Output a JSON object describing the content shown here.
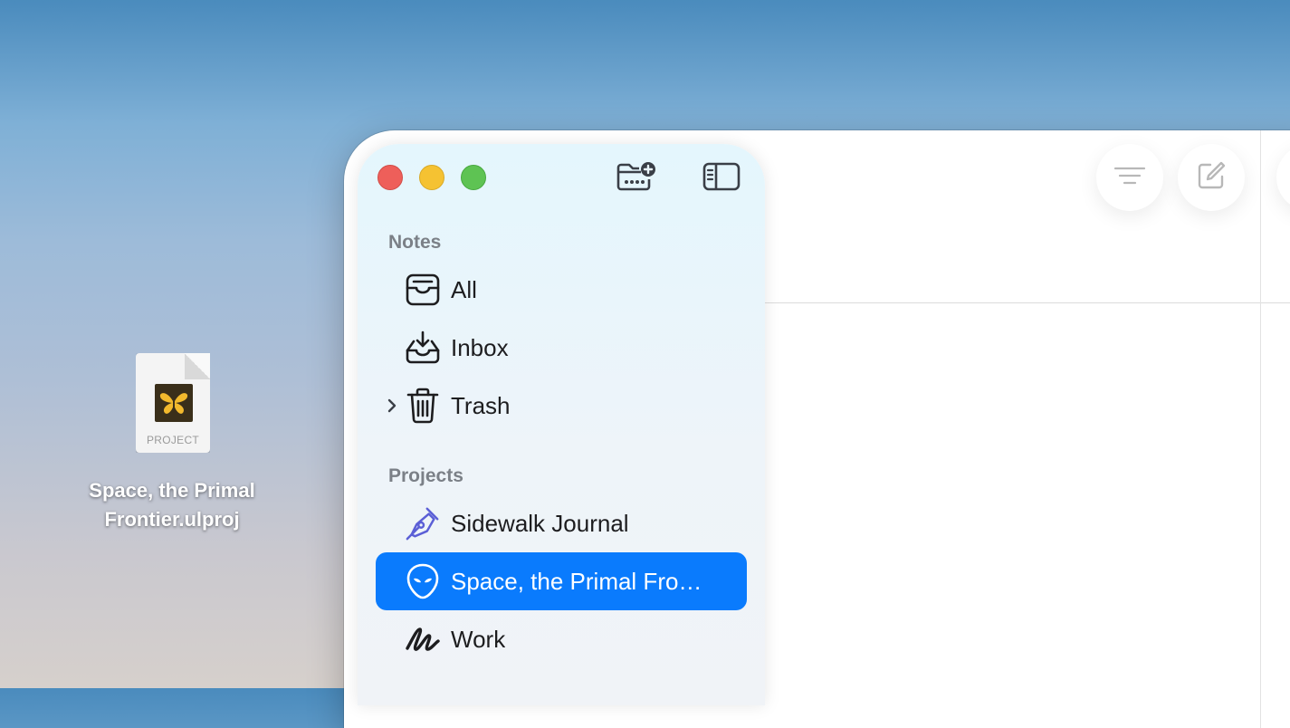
{
  "desktop": {
    "file": {
      "name_line1": "Space, the Primal",
      "name_line2": "Frontier.ulproj",
      "badge": "PROJECT",
      "icon": "butterfly-icon"
    }
  },
  "window": {
    "toolbar": {
      "sort_icon": "sort-lines-icon",
      "compose_icon": "compose-icon",
      "new_group_icon": "folder-add-icon",
      "sidebar_toggle_icon": "sidebar-toggle-icon"
    },
    "sidebar": {
      "notes_header": "Notes",
      "notes_items": [
        {
          "label": "All",
          "icon": "tray-icon"
        },
        {
          "label": "Inbox",
          "icon": "inbox-download-icon"
        },
        {
          "label": "Trash",
          "icon": "trash-icon"
        }
      ],
      "projects_header": "Projects",
      "project_items": [
        {
          "label": "Sidewalk Journal",
          "icon": "fountain-pen-icon"
        },
        {
          "label": "Space, the Primal Fro…",
          "icon": "alien-icon",
          "selected": true
        },
        {
          "label": "Work",
          "icon": "scribble-icon"
        }
      ]
    },
    "colors": {
      "selection": "#0a7bfd",
      "sidebar_bg": "#e4f6fd",
      "pen_icon": "#5b5fd6"
    }
  }
}
